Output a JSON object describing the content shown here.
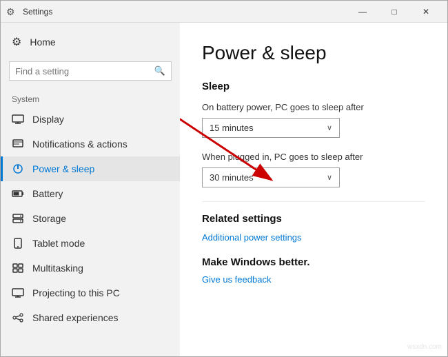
{
  "window": {
    "title": "Settings",
    "titleIcon": "⚙"
  },
  "titleBarControls": {
    "minimize": "—",
    "maximize": "□",
    "close": "✕"
  },
  "sidebar": {
    "homeLabel": "Home",
    "searchPlaceholder": "Find a setting",
    "sectionLabel": "System",
    "items": [
      {
        "id": "display",
        "label": "Display",
        "icon": "🖥"
      },
      {
        "id": "notifications",
        "label": "Notifications & actions",
        "icon": "🔔"
      },
      {
        "id": "power",
        "label": "Power & sleep",
        "icon": "⏻",
        "active": true
      },
      {
        "id": "battery",
        "label": "Battery",
        "icon": "🔋"
      },
      {
        "id": "storage",
        "label": "Storage",
        "icon": "💾"
      },
      {
        "id": "tablet",
        "label": "Tablet mode",
        "icon": "📱"
      },
      {
        "id": "multitasking",
        "label": "Multitasking",
        "icon": "⊞"
      },
      {
        "id": "projecting",
        "label": "Projecting to this PC",
        "icon": "📽"
      },
      {
        "id": "shared",
        "label": "Shared experiences",
        "icon": "🔗"
      }
    ]
  },
  "main": {
    "pageTitle": "Power & sleep",
    "sleepSection": {
      "title": "Sleep",
      "batteryLabel": "On battery power, PC goes to sleep after",
      "batteryValue": "15 minutes",
      "pluggedLabel": "When plugged in, PC goes to sleep after",
      "pluggedValue": "30 minutes"
    },
    "relatedSection": {
      "title": "Related settings",
      "linkLabel": "Additional power settings"
    },
    "makeSection": {
      "title": "Make Windows better.",
      "linkLabel": "Give us feedback"
    }
  },
  "watermark": "wsxdn.com"
}
